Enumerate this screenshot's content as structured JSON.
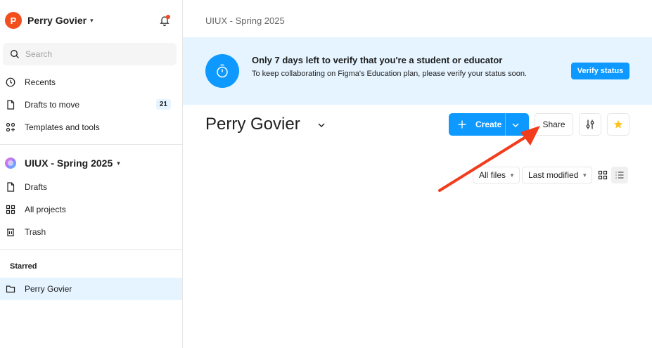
{
  "user": {
    "initial": "P",
    "name": "Perry Govier"
  },
  "search": {
    "placeholder": "Search"
  },
  "nav": {
    "recents": "Recents",
    "drafts_to_move": "Drafts to move",
    "drafts_to_move_count": "21",
    "templates": "Templates and tools"
  },
  "team": {
    "name": "UIUX - Spring 2025",
    "drafts": "Drafts",
    "all_projects": "All projects",
    "trash": "Trash"
  },
  "starred": {
    "label": "Starred",
    "items": [
      "Perry Govier"
    ]
  },
  "main": {
    "breadcrumb": "UIUX - Spring 2025",
    "page_title": "Perry Govier"
  },
  "banner": {
    "title": "Only 7 days left to verify that you're a student or educator",
    "text": "To keep collaborating on Figma's Education plan, please verify your status soon.",
    "button": "Verify status"
  },
  "toolbar": {
    "create": "Create",
    "share": "Share"
  },
  "filters": {
    "files": "All files",
    "sort": "Last modified"
  },
  "colors": {
    "accent": "#0d99ff",
    "banner_bg": "#e5f4ff",
    "avatar": "#f24e1e",
    "annotation_arrow": "#f23c1c",
    "star": "#ffc21a"
  }
}
